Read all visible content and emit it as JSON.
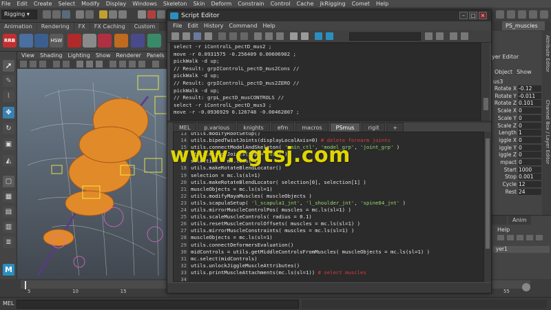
{
  "maya": {
    "menubar": [
      "File",
      "Edit",
      "Create",
      "Select",
      "Modify",
      "Display",
      "Windows",
      "Skeleton",
      "Skin",
      "Deform",
      "Constrain",
      "Control",
      "Cache",
      "jkRigging",
      "Comet",
      "Help"
    ],
    "mode": "Rigging",
    "shelf_tabs": [
      "Animation",
      "Rendering",
      "FX",
      "FX Caching",
      "Custom"
    ],
    "shelf_labels": [
      "RRB",
      "HSW"
    ],
    "panel_menu": [
      "View",
      "Shading",
      "Lighting",
      "Show",
      "Renderer",
      "Panels"
    ],
    "command_label": "MEL",
    "timeline_ticks": [
      "5",
      "10",
      "15",
      "20",
      "25",
      "30",
      "35",
      "40",
      "45",
      "50",
      "55"
    ]
  },
  "right_panels": {
    "top_tab": "PS_muscles",
    "layer_editor_label": "yer Editor",
    "attr_head": [
      "Object",
      "Show"
    ],
    "attr_partial_title": "us3",
    "attributes": [
      {
        "label": "Rotate X",
        "value": "-0.12"
      },
      {
        "label": "Rotate Y",
        "value": "-0.011"
      },
      {
        "label": "Rotate Z",
        "value": "0.101"
      },
      {
        "label": "Scale X",
        "value": "0"
      },
      {
        "label": "Scale Y",
        "value": "0"
      },
      {
        "label": "Scale Z",
        "value": "0"
      },
      {
        "label": "Length",
        "value": "1"
      },
      {
        "label": "iggle X",
        "value": "0"
      },
      {
        "label": "iggle Y",
        "value": "0"
      },
      {
        "label": "iggle Z",
        "value": "0"
      },
      {
        "label": "mpact",
        "value": "0"
      },
      {
        "label": "Start",
        "value": "1000"
      },
      {
        "label": "Stop",
        "value": "0.001"
      },
      {
        "label": "Cycle",
        "value": "12"
      },
      {
        "label": "Rest",
        "value": "24"
      }
    ],
    "vtabs": [
      "Attribute Editor",
      "Channel Box / Layer Editor"
    ],
    "layer_tabs": [
      "Anim"
    ],
    "layer_help": "Help",
    "layer_item": "yer1"
  },
  "script_editor": {
    "title": "Script Editor",
    "menus": [
      "File",
      "Edit",
      "History",
      "Command",
      "Help"
    ],
    "history": [
      "select -r iControlL_pectD_mus2 ;",
      "move -r 0.0931575 -0.256409 0.00606902 ;",
      "pickWalk -d up;",
      "// Result: grpIControlL_pectD_mus2Cons //",
      "pickWalk -d up;",
      "// Result: grpIControlL_pectD_mus2ZERO //",
      "pickWalk -d up;",
      "// Result: grpL_pectD_musCONTROLS //",
      "select -r iControlL_pectD_mus3 ;",
      "move -r -0.0936929 0.126748 -0.00462807 ;"
    ],
    "tabs": [
      "MEL",
      "p.various",
      "knights",
      "efm",
      "macros",
      "PSmus",
      "rigit",
      "+"
    ],
    "active_tab": "PSmus",
    "code": [
      {
        "n": "13",
        "t": "utils.modifyRootSetup()"
      },
      {
        "n": "14",
        "t": "utils.bipedTwistJoints(displayLocalAxis=0) # delete forearm joints"
      },
      {
        "n": "15",
        "t": "utils.connectModelAndSkeleton( 'main_ctl', 'model_grp', 'joint_grp' )"
      },
      {
        "n": "16",
        "t": "utils.mirrorJoints(type='joint')"
      },
      {
        "n": "17",
        "t": "selection = mc.ls(sl=1)"
      },
      {
        "n": "18",
        "t": "utils.makeRotateBlendLocator()"
      },
      {
        "n": "19",
        "t": "selection = mc.ls(sl=1)"
      },
      {
        "n": "20",
        "t": "utils.makeRotateBlendLocator( selection[0], selection[1] )"
      },
      {
        "n": "21",
        "t": "muscleObjects = mc.ls(sl=1)"
      },
      {
        "n": "22",
        "t": "utils.modifyMayaMuscles( muscleObjects )"
      },
      {
        "n": "23",
        "t": "utils.scapulaSetup( 'l_scapula1_jnt', 'l_shoulder_jnt', 'spine04_jnt' )"
      },
      {
        "n": "24",
        "t": "utils.mirrorMuscleControlPos( muscles = mc.ls(sl=1) )"
      },
      {
        "n": "25",
        "t": "utils.scaleMuscleControls( radius = 0.1)"
      },
      {
        "n": "26",
        "t": "utils.resetMuscleControlOffsets( muscles = mc.ls(sl=1) )"
      },
      {
        "n": "27",
        "t": "utils.mirrorMuscleConstraints( muscles = mc.ls(sl=1) )"
      },
      {
        "n": "28",
        "t": "muscleObjects = mc.ls(sl=1)"
      },
      {
        "n": "29",
        "t": "utils.connectDeformersEvaluation()"
      },
      {
        "n": "30",
        "t": "midControls = utils.getMiddleControlsFromMuscles( muscleObjects = mc.ls(sl=1) )"
      },
      {
        "n": "31",
        "t": "mc.select(midControls)"
      },
      {
        "n": "32",
        "t": "utils.unlockJiggleMuscleAttributes()"
      },
      {
        "n": "33",
        "t": "utils.printMuscleAttachments(mc.ls(sl=1)) # select muscles"
      },
      {
        "n": "34",
        "t": ""
      },
      {
        "n": "35",
        "t": "reload(utils)"
      }
    ]
  },
  "watermark": "www.cgtsj.com",
  "colors": {
    "accent_blue": "#2a8fbf",
    "comment_red": "#e03a3a",
    "string_green": "#9ad66e",
    "watermark_yellow": "#e0d600",
    "muscle_orange": "#e08a2a"
  }
}
